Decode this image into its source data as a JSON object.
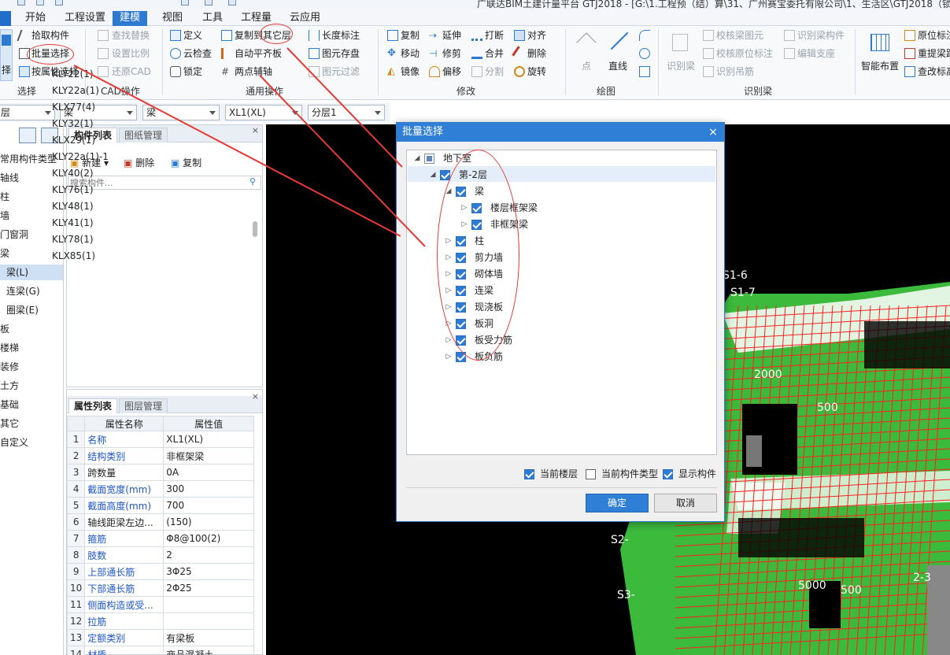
{
  "title_bar": {
    "text": "广联达BIM土建计量平台 GTJ2018 - [G:\\1.工程预（结）算\\31、广州赛宝委托有限公司\\1、生活区\\GTJ2018（锁"
  },
  "menu": [
    "开始",
    "工程设置",
    "建模",
    "视图",
    "工具",
    "工程量",
    "云应用"
  ],
  "ribbon": {
    "select": {
      "items": [
        "拾取构件",
        "批量选择",
        "按属性选择"
      ],
      "big_label": "择",
      "group": "选择"
    },
    "cad": {
      "items": [
        "查找替换",
        "设置比例",
        "还原CAD"
      ],
      "group": "CAD操作"
    },
    "general": {
      "col1": [
        "定义",
        "云检查",
        "锁定"
      ],
      "col2": [
        "复制到其它层",
        "自动平齐板",
        "两点辅轴"
      ],
      "col3": [
        "长度标注",
        "图元存盘",
        "图元过滤"
      ],
      "group": "通用操作"
    },
    "modify": {
      "col1": [
        "复制",
        "移动",
        "镜像"
      ],
      "col2": [
        "延伸",
        "修剪",
        "偏移"
      ],
      "col3": [
        "打断",
        "合并",
        "分割"
      ],
      "col4": [
        "对齐",
        "删除",
        "旋转"
      ],
      "group": "修改"
    },
    "draw": {
      "items": [
        "点",
        "直线"
      ],
      "group": "绘图"
    },
    "identify": {
      "big": "识别梁",
      "col1": [
        "校核梁图元",
        "校核原位标注",
        "识别吊筋"
      ],
      "col2": [
        "识别梁构件",
        "编辑支座"
      ],
      "group": "识别梁"
    },
    "smart": {
      "big": "智能布置",
      "items": [
        "原位标注",
        "重提梁跨",
        "查改标高"
      ]
    }
  },
  "selectors": [
    "层",
    "梁",
    "梁",
    "XL1(XL)",
    "分层1"
  ],
  "left_nav": [
    {
      "label": "常用构件类型"
    },
    {
      "label": "轴线"
    },
    {
      "label": "柱"
    },
    {
      "label": "墙"
    },
    {
      "label": "门窗洞"
    },
    {
      "label": "梁"
    },
    {
      "label": "梁(L)",
      "active": true
    },
    {
      "label": "连梁(G)"
    },
    {
      "label": "圈梁(E)"
    },
    {
      "label": "板"
    },
    {
      "label": "楼梯"
    },
    {
      "label": "装修"
    },
    {
      "label": "土方"
    },
    {
      "label": "基础"
    },
    {
      "label": "其它"
    },
    {
      "label": "自定义"
    }
  ],
  "component_panel": {
    "tabs": [
      "构件列表",
      "图纸管理"
    ],
    "toolbar": [
      "新建",
      "删除",
      "复制"
    ],
    "search_placeholder": "搜索构件...",
    "items": [
      "KLY22(1)",
      "KLY22a(1)",
      "KLX77(4)",
      "KLY32(1)",
      "KLX29(1)",
      "KLY22a(1)-1",
      "KLY40(2)",
      "KLY76(1)",
      "KLY48(1)",
      "KLY41(1)",
      "KLY78(1)",
      "KLX85(1)"
    ]
  },
  "property_panel": {
    "tabs": [
      "属性列表",
      "图层管理"
    ],
    "header": [
      "属性名称",
      "属性值"
    ],
    "rows": [
      {
        "n": "1",
        "k": "名称",
        "v": "XL1(XL)",
        "blue": true
      },
      {
        "n": "2",
        "k": "结构类别",
        "v": "非框架梁",
        "blue": true
      },
      {
        "n": "3",
        "k": "跨数量",
        "v": "0A",
        "blue": false
      },
      {
        "n": "4",
        "k": "截面宽度(mm)",
        "v": "300",
        "blue": true
      },
      {
        "n": "5",
        "k": "截面高度(mm)",
        "v": "700",
        "blue": true
      },
      {
        "n": "6",
        "k": "轴线距梁左边...",
        "v": "(150)",
        "blue": false
      },
      {
        "n": "7",
        "k": "箍筋",
        "v": "Φ8@100(2)",
        "blue": true
      },
      {
        "n": "8",
        "k": "肢数",
        "v": "2",
        "blue": true
      },
      {
        "n": "9",
        "k": "上部通长筋",
        "v": "3Φ25",
        "blue": true
      },
      {
        "n": "10",
        "k": "下部通长筋",
        "v": "2Φ25",
        "blue": true
      },
      {
        "n": "11",
        "k": "侧面构造或受...",
        "v": "",
        "blue": true
      },
      {
        "n": "12",
        "k": "拉筋",
        "v": "",
        "blue": true
      },
      {
        "n": "13",
        "k": "定额类别",
        "v": "有梁板",
        "blue": true
      },
      {
        "n": "14",
        "k": "材质",
        "v": "商品混凝土",
        "blue": true
      }
    ]
  },
  "dialog": {
    "title": "批量选择",
    "close": "×",
    "tree": {
      "root": "地下室",
      "floor": "第-2层",
      "beam": "梁",
      "beam_children": [
        "楼层框架梁",
        "非框架梁"
      ],
      "others": [
        "柱",
        "剪力墙",
        "砌体墙",
        "连梁",
        "现浇板",
        "板洞",
        "板受力筋",
        "板负筋"
      ]
    },
    "options": [
      {
        "label": "当前楼层",
        "checked": true
      },
      {
        "label": "当前构件类型",
        "checked": false
      },
      {
        "label": "显示构件",
        "checked": true
      }
    ],
    "ok": "确定",
    "cancel": "取消"
  },
  "canvas_labels": [
    "S1-6",
    "S1-7",
    "2000",
    "500",
    "S2-",
    "S3-",
    "2-3",
    "5000",
    "500"
  ],
  "colors": {
    "accent": "#2e7ad1",
    "annotation": "#e53935",
    "canvas": "#000000",
    "slab": "#3cba3c",
    "grid": "#ff2020"
  }
}
